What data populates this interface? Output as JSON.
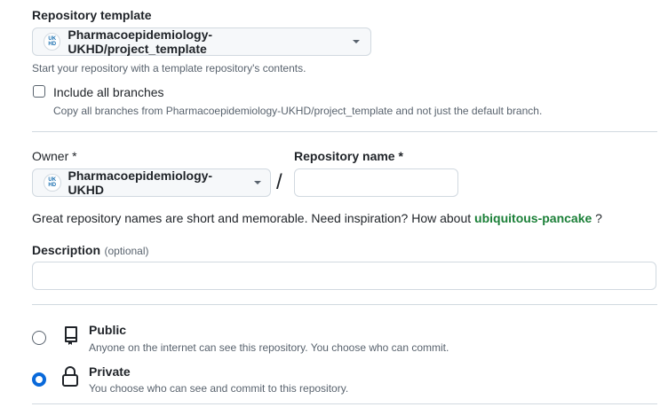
{
  "template": {
    "label": "Repository template",
    "selected": "Pharmacoepidemiology-UKHD/project_template",
    "avatar_text": "UK HD",
    "help": "Start your repository with a template repository's contents."
  },
  "branches": {
    "label": "Include all branches",
    "help": "Copy all branches from Pharmacoepidemiology-UKHD/project_template and not just the default branch.",
    "checked": false
  },
  "owner": {
    "label": "Owner *",
    "selected": "Pharmacoepidemiology-UKHD",
    "avatar_text": "UK HD"
  },
  "separator": "/",
  "repo_name": {
    "label": "Repository name *",
    "value": ""
  },
  "suggestion": {
    "prefix": "Great repository names are short and memorable. Need inspiration? How about",
    "name": "ubiquitous-pancake",
    "suffix": " ?"
  },
  "description": {
    "label": "Description",
    "optional": "(optional)",
    "value": ""
  },
  "visibility": {
    "options": [
      {
        "title": "Public",
        "help": "Anyone on the internet can see this repository. You choose who can commit.",
        "checked": false
      },
      {
        "title": "Private",
        "help": "You choose who can see and commit to this repository.",
        "checked": true
      }
    ]
  },
  "colors": {
    "accent": "#0969da",
    "suggestion": "#1a7f37",
    "border": "#d1d9e0",
    "muted": "#59636e"
  }
}
